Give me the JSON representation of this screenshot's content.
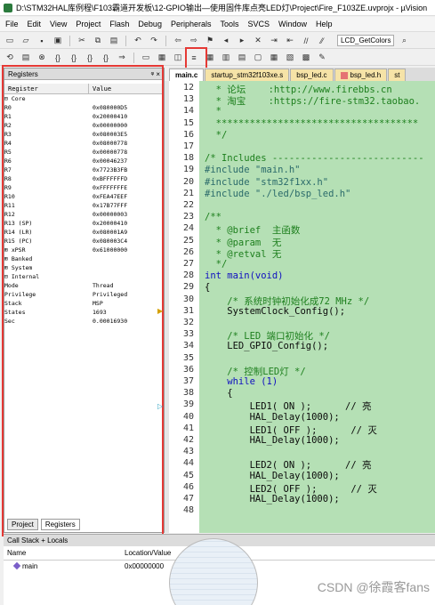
{
  "window": {
    "title": "D:\\STM32HAL库例程\\F103霸道开发板\\12-GPIO输出—使用固件库点亮LED灯\\Project\\Fire_F103ZE.uvprojx - µVision"
  },
  "menu": [
    "File",
    "Edit",
    "View",
    "Project",
    "Flash",
    "Debug",
    "Peripherals",
    "Tools",
    "SVCS",
    "Window",
    "Help"
  ],
  "toolbar": {
    "target_combo": "LCD_GetColors"
  },
  "tabs": [
    {
      "label": "main.c",
      "active": true
    },
    {
      "label": "startup_stm32f103xe.s",
      "active": false
    },
    {
      "label": "bsp_led.c",
      "active": false
    },
    {
      "label": "bsp_led.h",
      "active": false
    },
    {
      "label": "st",
      "active": false
    }
  ],
  "registers": {
    "title": "Registers",
    "pin": "ᵠ",
    "close": "×",
    "col_register": "Register",
    "col_value": "Value",
    "rows": [
      {
        "name": "⊟ Core",
        "value": ""
      },
      {
        "name": "    R0",
        "value": "0x080000D5"
      },
      {
        "name": "    R1",
        "value": "0x20000410"
      },
      {
        "name": "    R2",
        "value": "0x00000000"
      },
      {
        "name": "    R3",
        "value": "0x080003E5"
      },
      {
        "name": "    R4",
        "value": "0x08000778"
      },
      {
        "name": "    R5",
        "value": "0x00000778"
      },
      {
        "name": "    R6",
        "value": "0x00046237"
      },
      {
        "name": "    R7",
        "value": "0x7723B3FB"
      },
      {
        "name": "    R8",
        "value": "0xBFFFFFFD"
      },
      {
        "name": "    R9",
        "value": "0xFFFFFFFE"
      },
      {
        "name": "    R10",
        "value": "0xFEA47EEF"
      },
      {
        "name": "    R11",
        "value": "0x17B77FFF"
      },
      {
        "name": "    R12",
        "value": "0x00000003"
      },
      {
        "name": "    R13 (SP)",
        "value": "0x20000410"
      },
      {
        "name": "    R14 (LR)",
        "value": "0x080001A9"
      },
      {
        "name": "    R15 (PC)",
        "value": "0x080003C4"
      },
      {
        "name": "  ⊞ xPSR",
        "value": "0x61000000"
      },
      {
        "name": "⊞ Banked",
        "value": ""
      },
      {
        "name": "⊞ System",
        "value": ""
      },
      {
        "name": "⊟ Internal",
        "value": ""
      },
      {
        "name": "    Mode",
        "value": "Thread"
      },
      {
        "name": "    Privilege",
        "value": "Privileged"
      },
      {
        "name": "    Stack",
        "value": "MSP"
      },
      {
        "name": "    States",
        "value": "1693"
      },
      {
        "name": "    Sec",
        "value": "0.00016930"
      }
    ],
    "tab_project": "Project",
    "tab_registers": "Registers"
  },
  "editor": {
    "lines": [
      {
        "n": "12",
        "text": "  * 论坛    :http://www.firebbs.cn",
        "cls": "c-comment"
      },
      {
        "n": "13",
        "text": "  * 淘宝    :https://fire-stm32.taobao.",
        "cls": "c-comment"
      },
      {
        "n": "14",
        "text": "  *",
        "cls": "c-comment"
      },
      {
        "n": "15",
        "text": "  ************************************",
        "cls": "c-comment"
      },
      {
        "n": "16",
        "text": "  */",
        "cls": "c-comment"
      },
      {
        "n": "17",
        "text": "",
        "cls": ""
      },
      {
        "n": "18",
        "text": "/* Includes ---------------------------",
        "cls": "c-comment"
      },
      {
        "n": "19",
        "text": "#include \"main.h\"",
        "cls": "c-pre"
      },
      {
        "n": "20",
        "text": "#include \"stm32f1xx.h\"",
        "cls": "c-pre"
      },
      {
        "n": "21",
        "text": "#include \"./led/bsp_led.h\"",
        "cls": "c-pre"
      },
      {
        "n": "22",
        "text": "",
        "cls": ""
      },
      {
        "n": "23",
        "text": "/**",
        "cls": "c-comment"
      },
      {
        "n": "24",
        "text": "  * @brief  主函数",
        "cls": "c-comment"
      },
      {
        "n": "25",
        "text": "  * @param  无",
        "cls": "c-comment"
      },
      {
        "n": "26",
        "text": "  * @retval 无",
        "cls": "c-comment"
      },
      {
        "n": "27",
        "text": "  */",
        "cls": "c-comment"
      },
      {
        "n": "28",
        "text": "int main(void)",
        "cls": "c-kw"
      },
      {
        "n": "29",
        "text": "{",
        "cls": ""
      },
      {
        "n": "30",
        "text": "    /* 系统时钟初始化成72 MHz */",
        "cls": "c-comment"
      },
      {
        "n": "31",
        "text": "    SystemClock_Config();",
        "cls": ""
      },
      {
        "n": "32",
        "text": "",
        "cls": ""
      },
      {
        "n": "33",
        "text": "    /* LED 端口初始化 */",
        "cls": "c-comment"
      },
      {
        "n": "34",
        "text": "    LED_GPIO_Config();",
        "cls": ""
      },
      {
        "n": "35",
        "text": "",
        "cls": ""
      },
      {
        "n": "36",
        "text": "    /* 控制LED灯 */",
        "cls": "c-comment"
      },
      {
        "n": "37",
        "text": "    while (1)",
        "cls": "c-kw"
      },
      {
        "n": "38",
        "text": "    {",
        "cls": ""
      },
      {
        "n": "39",
        "text": "        LED1( ON );      // 亮",
        "cls": ""
      },
      {
        "n": "40",
        "text": "        HAL_Delay(1000);",
        "cls": ""
      },
      {
        "n": "41",
        "text": "        LED1( OFF );      // 灭",
        "cls": ""
      },
      {
        "n": "42",
        "text": "        HAL_Delay(1000);",
        "cls": ""
      },
      {
        "n": "43",
        "text": "",
        "cls": ""
      },
      {
        "n": "44",
        "text": "        LED2( ON );      // 亮",
        "cls": ""
      },
      {
        "n": "45",
        "text": "        HAL_Delay(1000);",
        "cls": ""
      },
      {
        "n": "46",
        "text": "        LED2( OFF );      // 灭",
        "cls": ""
      },
      {
        "n": "47",
        "text": "        HAL_Delay(1000);",
        "cls": ""
      },
      {
        "n": "48",
        "text": "",
        "cls": ""
      }
    ]
  },
  "callstack": {
    "title": "Call Stack + Locals",
    "col_name": "Name",
    "col_location": "Location/Value",
    "rows": [
      {
        "name": "main",
        "location": "0x00000000"
      }
    ]
  },
  "watermark": "CSDN @徐霞客fans"
}
